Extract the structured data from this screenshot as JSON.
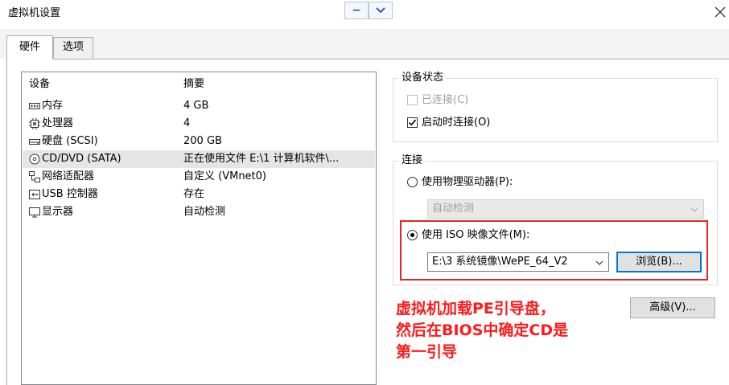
{
  "window": {
    "title": "虚拟机设置",
    "minimize_label": "−",
    "dropdown_label": "⌄"
  },
  "tabs": [
    {
      "label": "硬件",
      "active": true
    },
    {
      "label": "选项",
      "active": false
    }
  ],
  "device_list": {
    "columns": [
      "设备",
      "摘要"
    ],
    "rows": [
      {
        "icon": "memory-icon",
        "name": "内存",
        "summary": "4 GB",
        "selected": false
      },
      {
        "icon": "processor-icon",
        "name": "处理器",
        "summary": "4",
        "selected": false
      },
      {
        "icon": "hard-disk-icon",
        "name": "硬盘 (SCSI)",
        "summary": "200 GB",
        "selected": false
      },
      {
        "icon": "cd-dvd-icon",
        "name": "CD/DVD (SATA)",
        "summary": "正在使用文件 E:\\1 计算机软件\\...",
        "selected": true
      },
      {
        "icon": "network-adapter-icon",
        "name": "网络适配器",
        "summary": "自定义 (VMnet0)",
        "selected": false
      },
      {
        "icon": "usb-controller-icon",
        "name": "USB 控制器",
        "summary": "存在",
        "selected": false
      },
      {
        "icon": "display-icon",
        "name": "显示器",
        "summary": "自动检测",
        "selected": false
      }
    ]
  },
  "device_status": {
    "title": "设备状态",
    "connected_label": "已连接(C)",
    "connected_checked": false,
    "connected_enabled": false,
    "connect_at_power_on_label": "启动时连接(O)",
    "connect_at_power_on_checked": true
  },
  "connection": {
    "title": "连接",
    "physical_drive_label": "使用物理驱动器(P):",
    "physical_drive_selected": false,
    "physical_drive_value": "自动检测",
    "iso_label": "使用 ISO 映像文件(M):",
    "iso_selected": true,
    "iso_path": "E:\\3 系统镜像\\WePE_64_V2",
    "browse_label": "浏览(B)..."
  },
  "advanced_label": "高级(V)...",
  "annotation": {
    "lines": [
      "虚拟机加载PE引导盘，",
      "然后在BIOS中确定CD是",
      "第一引导"
    ]
  },
  "colors": {
    "annotation": "#ff1a1a",
    "highlight_border": "#e52525",
    "selection": "#e5e5e5",
    "focus": "#0078d7"
  }
}
